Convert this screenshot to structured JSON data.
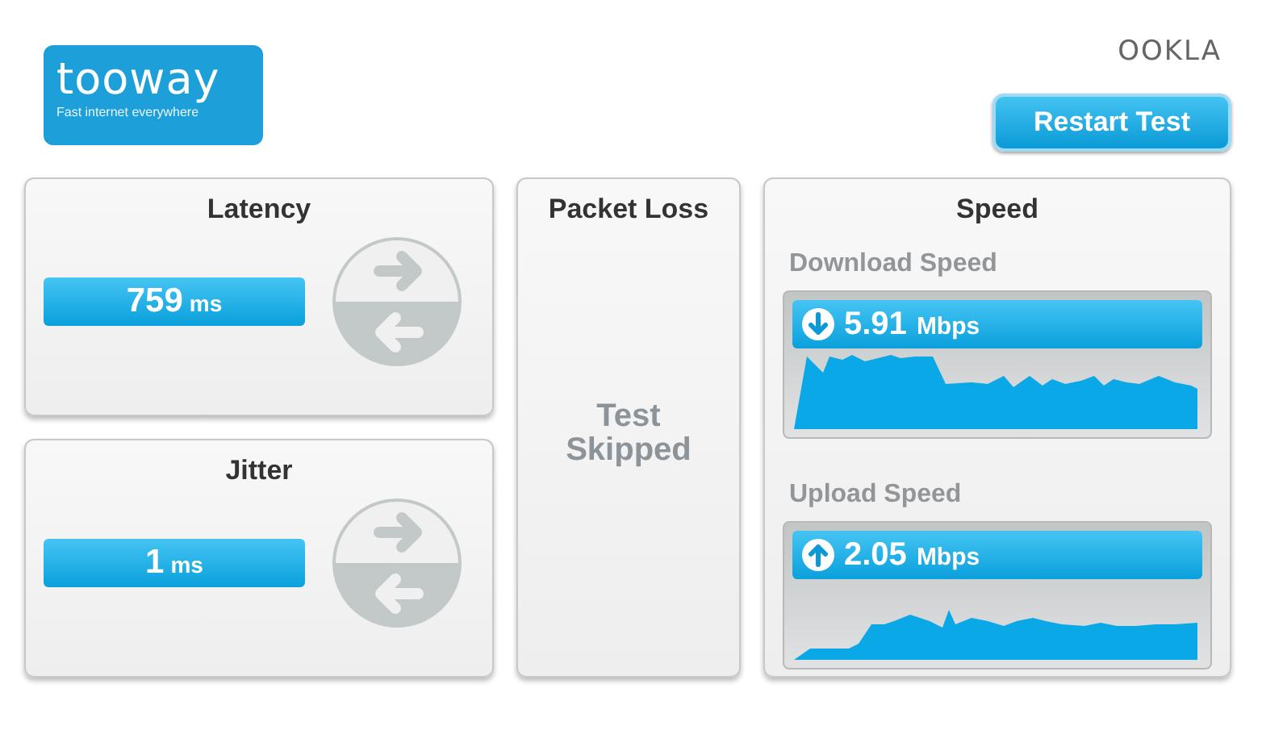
{
  "header": {
    "logo": {
      "name": "tooway",
      "tagline": "Fast internet everywhere"
    },
    "brand": "OOKLA",
    "restart_button": "Restart Test"
  },
  "latency": {
    "title": "Latency",
    "value": "759",
    "unit": "ms"
  },
  "jitter": {
    "title": "Jitter",
    "value": "1",
    "unit": "ms"
  },
  "packet_loss": {
    "title": "Packet Loss",
    "status": "Test Skipped"
  },
  "speed": {
    "title": "Speed",
    "tests": [
      {
        "kind": "download",
        "label": "Download Speed",
        "value": "5.91",
        "unit": "Mbps"
      },
      {
        "kind": "upload",
        "label": "Upload Speed",
        "value": "2.05",
        "unit": "Mbps"
      }
    ]
  }
}
